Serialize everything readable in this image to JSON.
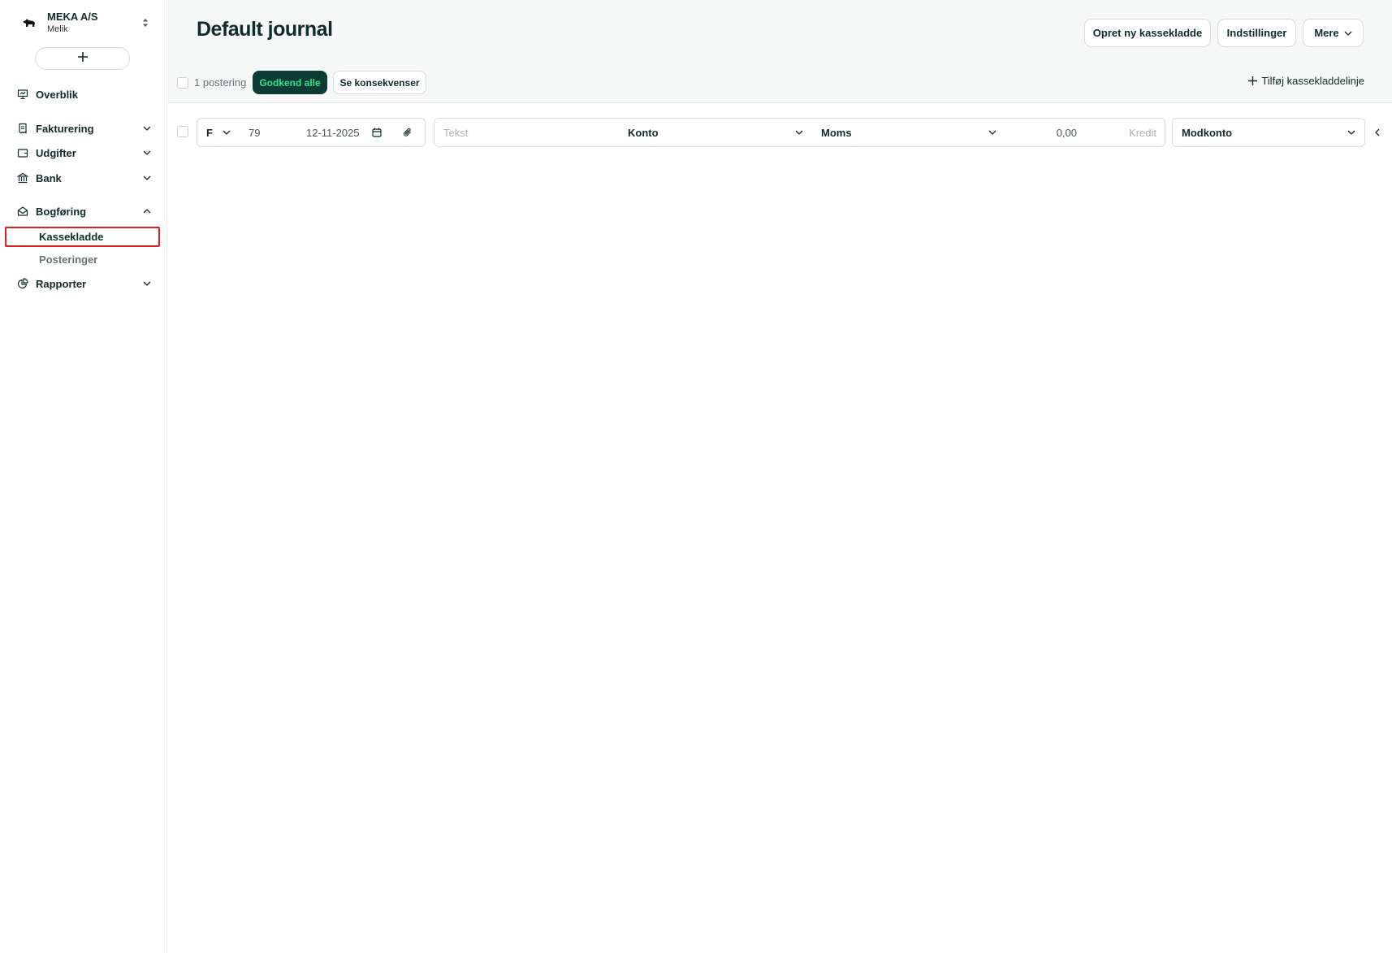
{
  "company": {
    "name": "MEKA A/S",
    "subtitle": "Melik"
  },
  "sidebar": {
    "add_symbol": "+",
    "items": [
      {
        "label": "Overblik"
      },
      {
        "label": "Fakturering"
      },
      {
        "label": "Udgifter"
      },
      {
        "label": "Bank"
      },
      {
        "label": "Bogføring"
      },
      {
        "label": "Rapporter"
      }
    ],
    "bogforing_sub": [
      {
        "label": "Kassekladde",
        "active": true
      },
      {
        "label": "Posteringer",
        "active": false
      }
    ]
  },
  "header": {
    "title": "Default journal",
    "buttons": {
      "new_journal": "Opret ny kassekladde",
      "settings": "Indstillinger",
      "more": "Mere"
    }
  },
  "toolbar": {
    "count_label": "1 postering",
    "approve_all": "Godkend alle",
    "see_consequences": "Se konsekvenser",
    "add_line": "Tilføj kassekladdelinje"
  },
  "journal_row": {
    "type": "F",
    "voucher_no": "79",
    "date": "12-11-2025",
    "text_placeholder": "Tekst",
    "account": "Konto",
    "vat": "Moms",
    "debit": "0,00",
    "credit_placeholder": "Kredit",
    "counter_account": "Modkonto"
  },
  "colors": {
    "primary_dark": "#0d3b36",
    "accent_green": "#35e08a",
    "highlight_red": "#e01e1e",
    "text": "#0f2b2b"
  }
}
